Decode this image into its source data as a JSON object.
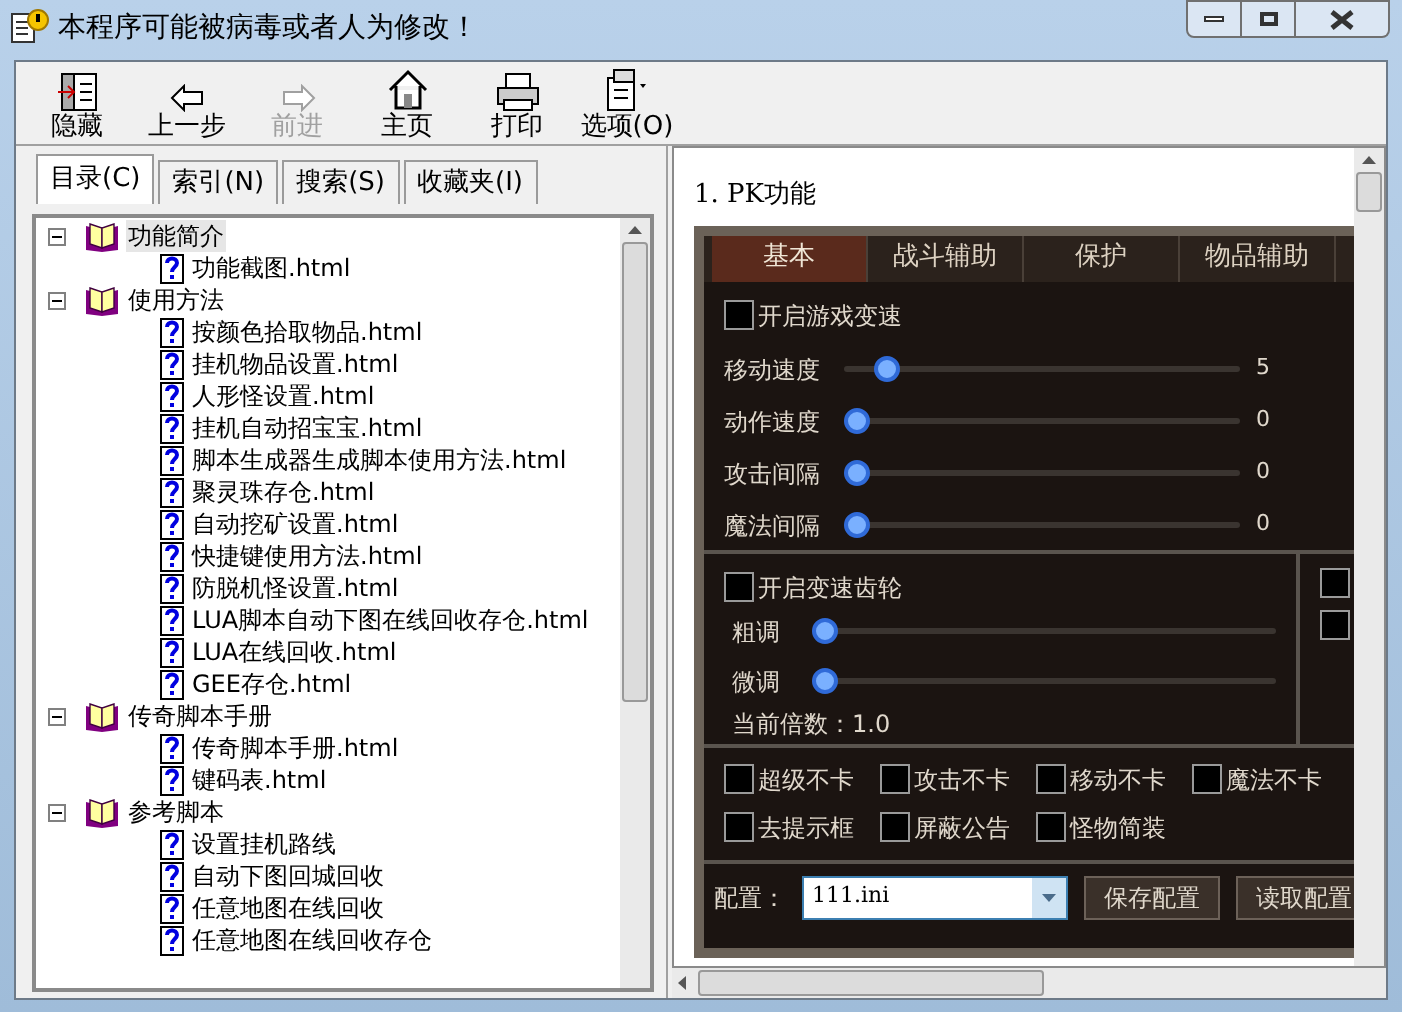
{
  "window": {
    "title": "本程序可能被病毒或者人为修改！"
  },
  "toolbar": [
    {
      "label": "隐藏",
      "kind": "hide",
      "disabled": false
    },
    {
      "label": "上一步",
      "kind": "back",
      "disabled": false
    },
    {
      "label": "前进",
      "kind": "forward",
      "disabled": true
    },
    {
      "label": "主页",
      "kind": "home",
      "disabled": false
    },
    {
      "label": "打印",
      "kind": "print",
      "disabled": false
    },
    {
      "label": "选项(O)",
      "kind": "options",
      "disabled": false
    }
  ],
  "nav_tabs": [
    {
      "label": "目录(C)",
      "selected": true
    },
    {
      "label": "索引(N)",
      "selected": false
    },
    {
      "label": "搜索(S)",
      "selected": false
    },
    {
      "label": "收藏夹(I)",
      "selected": false
    }
  ],
  "tree": [
    {
      "label": "功能简介",
      "expanded": true,
      "selected": true,
      "children": [
        {
          "label": "功能截图.html",
          "selected": false
        }
      ]
    },
    {
      "label": "使用方法",
      "expanded": true,
      "selected": false,
      "children": [
        {
          "label": "按颜色拾取物品.html",
          "selected": false
        },
        {
          "label": "挂机物品设置.html",
          "selected": false
        },
        {
          "label": "人形怪设置.html",
          "selected": false
        },
        {
          "label": "挂机自动招宝宝.html",
          "selected": false
        },
        {
          "label": "脚本生成器生成脚本使用方法.html",
          "selected": false
        },
        {
          "label": "聚灵珠存仓.html",
          "selected": false
        },
        {
          "label": "自动挖矿设置.html",
          "selected": false
        },
        {
          "label": "快捷键使用方法.html",
          "selected": false
        },
        {
          "label": "防脱机怪设置.html",
          "selected": false
        },
        {
          "label": "LUA脚本自动下图在线回收存仓.html",
          "selected": false
        },
        {
          "label": "LUA在线回收.html",
          "selected": false
        },
        {
          "label": "GEE存仓.html",
          "selected": false
        }
      ]
    },
    {
      "label": "传奇脚本手册",
      "expanded": true,
      "selected": false,
      "children": [
        {
          "label": "传奇脚本手册.html",
          "selected": false
        },
        {
          "label": "键码表.html",
          "selected": false
        }
      ]
    },
    {
      "label": "参考脚本",
      "expanded": true,
      "selected": false,
      "children": [
        {
          "label": "设置挂机路线",
          "selected": false
        },
        {
          "label": "自动下图回城回收",
          "selected": false
        },
        {
          "label": "任意地图在线回收",
          "selected": false
        },
        {
          "label": "任意地图在线回收存仓",
          "selected": false
        }
      ]
    }
  ],
  "content": {
    "heading": "1. PK功能",
    "game_panel": {
      "tabs": [
        {
          "label": "基本",
          "selected": true
        },
        {
          "label": "战斗辅助",
          "selected": false
        },
        {
          "label": "保护",
          "selected": false
        },
        {
          "label": "物品辅助",
          "selected": false
        }
      ],
      "speed_toggle": {
        "label": "开启游戏变速",
        "checked": false
      },
      "speed_sliders": [
        {
          "label": "移动速度",
          "level": 0.08,
          "reading": "5"
        },
        {
          "label": "动作速度",
          "level": 0,
          "reading": "0"
        },
        {
          "label": "攻击间隔",
          "level": 0,
          "reading": "0"
        },
        {
          "label": "魔法间隔",
          "level": 0,
          "reading": "0"
        }
      ],
      "gear_toggle": {
        "label": "开启变速齿轮",
        "checked": false
      },
      "gear_sliders": [
        {
          "label": "粗调",
          "level": 0
        },
        {
          "label": "微调",
          "level": 0
        }
      ],
      "multiplier": "当前倍数：1.0",
      "side_checkboxes": [
        {
          "checked": false
        },
        {
          "checked": false
        }
      ],
      "options": [
        {
          "label": "超级不卡",
          "checked": false
        },
        {
          "label": "攻击不卡",
          "checked": false
        },
        {
          "label": "移动不卡",
          "checked": false
        },
        {
          "label": "魔法不卡",
          "checked": false
        },
        {
          "label": "去提示框",
          "checked": false
        },
        {
          "label": "屏蔽公告",
          "checked": false
        },
        {
          "label": "怪物简装",
          "checked": false
        }
      ],
      "config_label": "配置：",
      "config_value": "111.ini",
      "buttons": [
        "保存配置",
        "读取配置"
      ]
    }
  }
}
